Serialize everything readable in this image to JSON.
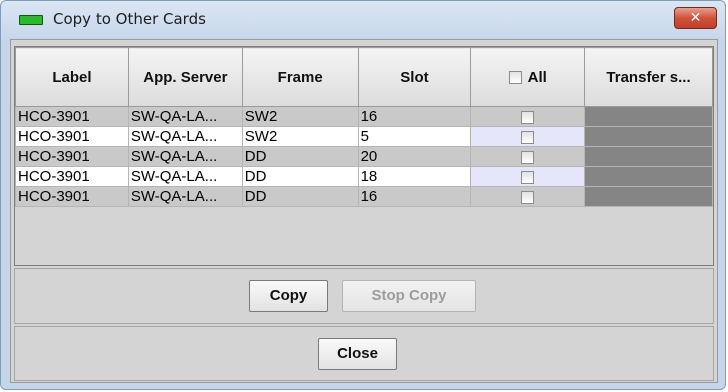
{
  "window": {
    "title": "Copy to Other Cards",
    "close_glyph": "✕",
    "accent_color": "#2eb82e"
  },
  "table": {
    "columns": [
      "Label",
      "App. Server",
      "Frame",
      "Slot",
      "All",
      "Transfer s..."
    ],
    "rows": [
      {
        "label": "HCO-3901",
        "app_server": "SW-QA-LA...",
        "frame": "SW2",
        "slot": "16",
        "checked": false
      },
      {
        "label": "HCO-3901",
        "app_server": "SW-QA-LA...",
        "frame": "SW2",
        "slot": "5",
        "checked": false
      },
      {
        "label": "HCO-3901",
        "app_server": "SW-QA-LA...",
        "frame": "DD",
        "slot": "20",
        "checked": false
      },
      {
        "label": "HCO-3901",
        "app_server": "SW-QA-LA...",
        "frame": "DD",
        "slot": "18",
        "checked": false
      },
      {
        "label": "HCO-3901",
        "app_server": "SW-QA-LA...",
        "frame": "DD",
        "slot": "16",
        "checked": false
      }
    ]
  },
  "buttons": {
    "copy": "Copy",
    "stop_copy": "Stop Copy",
    "close": "Close"
  }
}
